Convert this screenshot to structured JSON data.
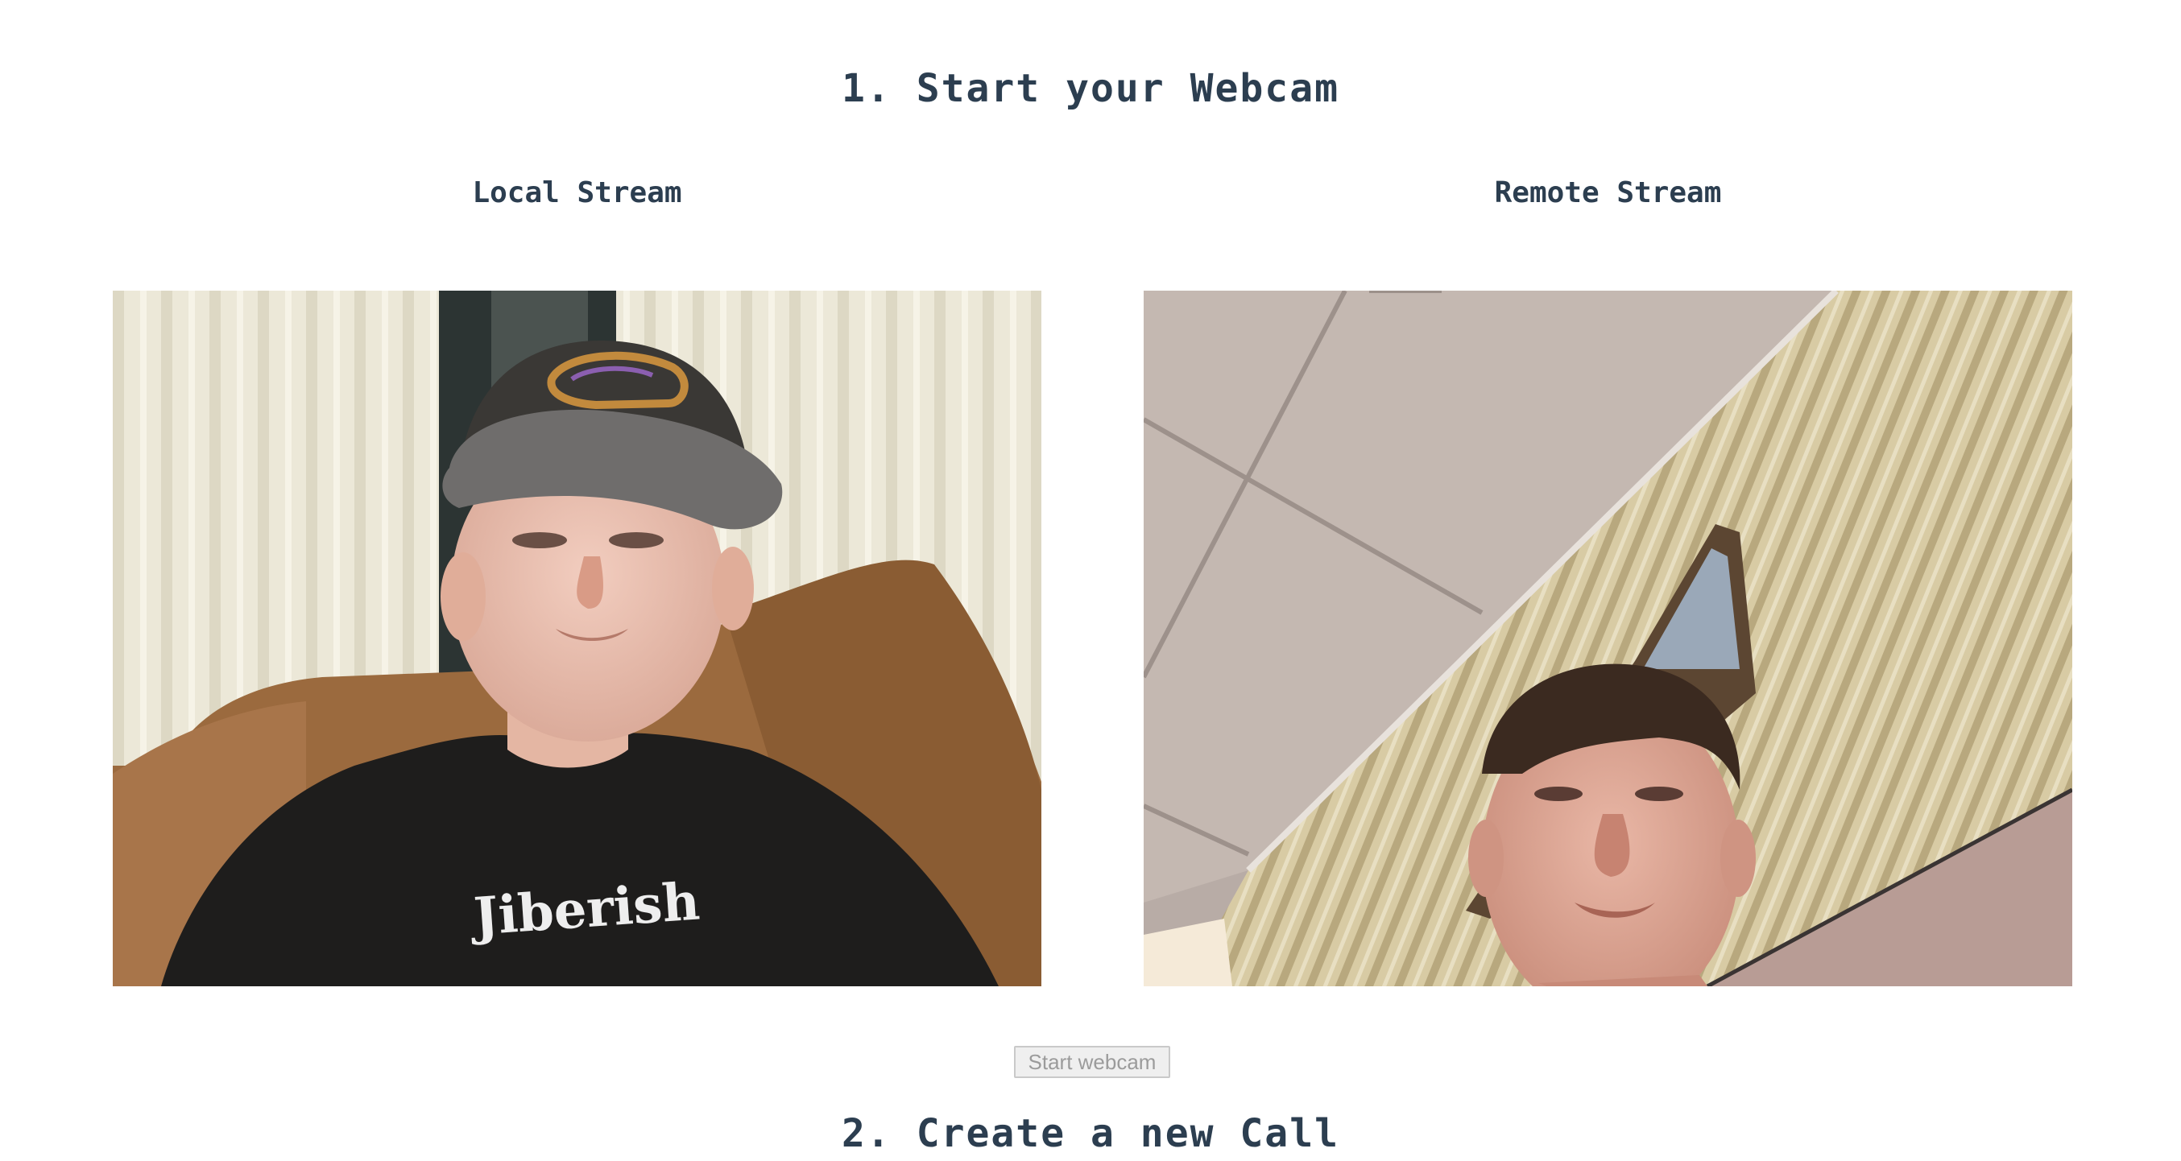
{
  "headings": {
    "step1": "1. Start your Webcam",
    "step2": "2. Create a new Call"
  },
  "streams": {
    "local": {
      "title": "Local Stream",
      "shirt_text": "Jiberish"
    },
    "remote": {
      "title": "Remote Stream"
    }
  },
  "controls": {
    "start_webcam_label": "Start webcam",
    "start_webcam_disabled": true
  },
  "colors": {
    "text": "#2c3e50",
    "button_bg": "#efefef",
    "button_text": "#9b9b9b"
  }
}
